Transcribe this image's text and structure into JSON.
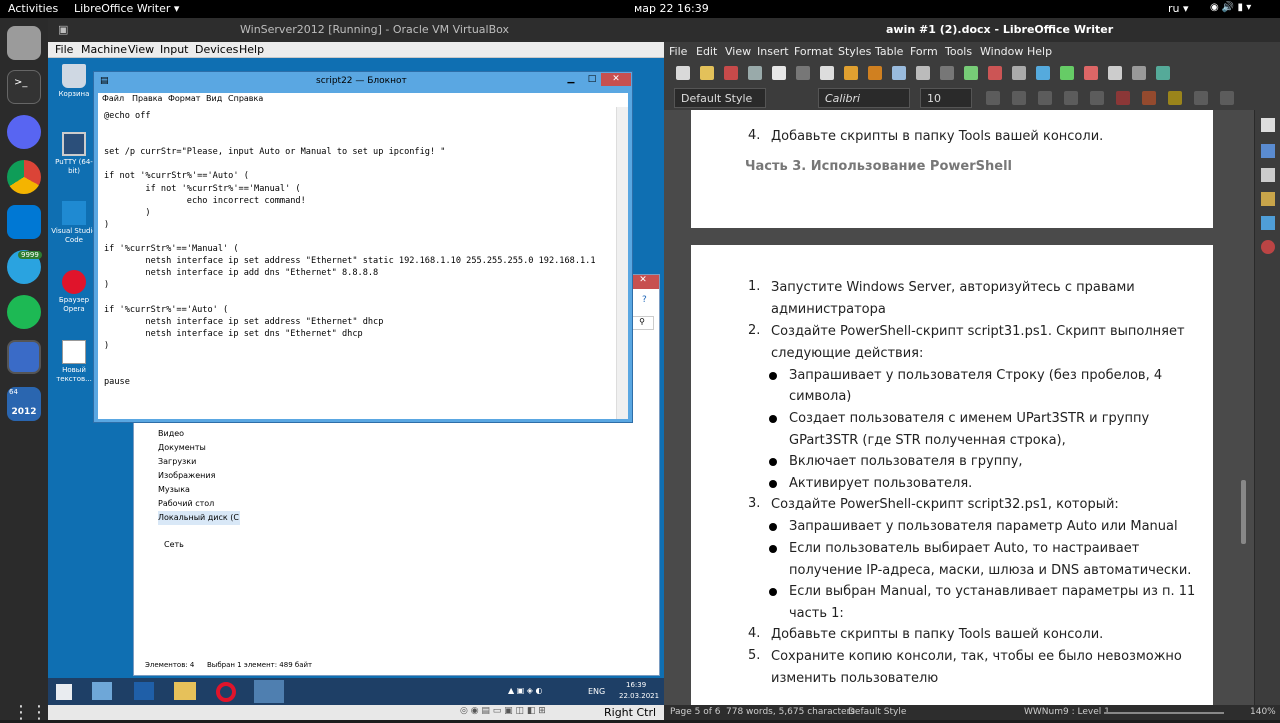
{
  "topbar": {
    "activities": "Activities",
    "app": "LibreOffice Writer",
    "clock": "мар 22  16:39",
    "lang": "ru"
  },
  "vbox": {
    "title": "WinServer2012 [Running] - Oracle VM VirtualBox",
    "menu": [
      "File",
      "Machine",
      "View",
      "Input",
      "Devices",
      "Help"
    ],
    "status": "Right Ctrl"
  },
  "desktop_icons": [
    {
      "label": "Корзина"
    },
    {
      "label": "PuTTY (64-bit)"
    },
    {
      "label": "Visual Studio Code"
    },
    {
      "label": "Браузер Opera"
    },
    {
      "label": "Новый текстов..."
    }
  ],
  "dock": {
    "badge": "9999",
    "vm_label": "2012",
    "vm_top": "64"
  },
  "notepad": {
    "title": "script22 — Блокнот",
    "menu": [
      "Файл",
      "Правка",
      "Формат",
      "Вид",
      "Справка"
    ],
    "text": "@echo off\n\n\nset /p currStr=\"Please, input Auto or Manual to set up ipconfig! \"\n\nif not '%currStr%'=='Auto' (\n        if not '%currStr%'=='Manual' (\n                echo incorrect command!\n        )\n)\n\nif '%currStr%'=='Manual' (\n        netsh interface ip set address \"Ethernet\" static 192.168.1.10 255.255.255.0 192.168.1.1\n        netsh interface ip add dns \"Ethernet\" 8.8.8.8\n)\n\nif '%currStr%'=='Auto' (\n        netsh interface ip set address \"Ethernet\" dhcp\n        netsh interface ip set dns \"Ethernet\" dhcp\n)\n\n\npause"
  },
  "explorer": {
    "tree": [
      "Видео",
      "Документы",
      "Загрузки",
      "Изображения",
      "Музыка",
      "Рабочий стол",
      "Локальный диск (С"
    ],
    "network": "Сеть",
    "status_count": "Элементов: 4",
    "status_sel": "Выбран 1 элемент: 489 байт"
  },
  "wintaskbar": {
    "lang": "ENG",
    "time": "16:39",
    "date": "22.03.2021"
  },
  "writer": {
    "title": "awin #1 (2).docx - LibreOffice Writer",
    "menu": [
      "File",
      "Edit",
      "View",
      "Insert",
      "Format",
      "Styles",
      "Table",
      "Form",
      "Tools",
      "Window",
      "Help"
    ],
    "style": "Default Style",
    "font": "Calibri",
    "size": "10",
    "page1": {
      "item4": "4.",
      "item4_text": "Добавьте скрипты в папку Tools вашей консоли.",
      "heading": "Часть 3. Использование PowerShell"
    },
    "page2": {
      "n1": "1.",
      "l1a": "Запустите     Windows     Server,    авторизуйтесь    с    правами",
      "l1b": "администратора",
      "n2": "2.",
      "l2a": "Создайте  PowerShell-скрипт  script31.ps1.  Скрипт  выполняет",
      "l2b": "следующие действия:",
      "b1a": "Запрашивает  у  пользователя  Строку  (без  пробелов,  4",
      "b1b": "символа)",
      "b2a": "Создает  пользователя  с  именем  UPart3STR     и  группу",
      "b2b": "GPart3STR (где STR полученная строка),",
      "b3": "Включает пользователя в группу,",
      "b4": "Активирует пользователя.",
      "n3": "3.",
      "l3": " Создайте PowerShell-скрипт script32.ps1, который:",
      "c1": "Запрашивает у пользователя параметр Auto или Manual",
      "c2a": "Если    пользователь    выбирает    Auto,    то    настраивает",
      "c2b": "получение IP-адреса, маски, шлюза и DNS автоматически.",
      "c3a": "Если выбран Manual, то устанавливает параметры из п. 11",
      "c3b": "часть 1:",
      "n4": "4.",
      "l4": "Добавьте скрипты в папку Tools вашей консоли.",
      "n5": "5.",
      "l5a": "Сохраните  копию  консоли,  так,  чтобы  ее  было  невозможно",
      "l5b": "изменить пользователю"
    },
    "status": {
      "page": "Page 5 of 6",
      "words": "778 words, 5,675 characters",
      "style": "Default Style",
      "lang": "WWNum9 : Level 1",
      "zoom": "140%"
    }
  },
  "colors": {
    "win_desktop": "#0f6fb2",
    "notepad_frame": "#5aa7e2",
    "lo_bg": "#3c3c3c"
  }
}
